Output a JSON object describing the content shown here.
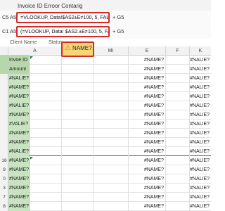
{
  "window": {
    "title": "Invoice ID Erroor Contarig"
  },
  "formula_rows": [
    {
      "ref": "C5",
      "ref2": "A5",
      "formula": "=VLOOKUP, Data!$AS2±E≠100, 5, FALSE)",
      "tail": "+ G5"
    },
    {
      "ref": "C1",
      "ref2": "A5",
      "formula": "(=VLOOKUP, Data! $AS2.±E≠100, 5, FALSE)",
      "tail": "+ G5"
    }
  ],
  "labels": {
    "client_name": "Client Name",
    "status": "Status"
  },
  "columns": [
    "A",
    "",
    "MI",
    "E",
    "F",
    "K"
  ],
  "error_badge": {
    "text": "NAME?"
  },
  "rows": [
    {
      "num": "",
      "a": "Invoe ID",
      "e": "#NAME?",
      "g": "#NALIE?",
      "flag": true
    },
    {
      "num": "",
      "a": "Amount",
      "e": "#NAME?",
      "g": "#NALIE?",
      "flag": false
    },
    {
      "num": "",
      "a": "#NALIE?",
      "e": "#NAME?",
      "g": "#NALIE?",
      "flag": false
    },
    {
      "num": "",
      "a": "#NAME?",
      "e": "#NAME?",
      "g": "#NALIE?",
      "flag": false
    },
    {
      "num": "",
      "a": "#NAME?",
      "e": "#NAME?",
      "g": "#NALIE?",
      "flag": false
    },
    {
      "num": "",
      "a": "#NALIE?",
      "e": "#NAME?",
      "g": "#NALIE?",
      "flag": false
    },
    {
      "num": "",
      "a": "#NAME?",
      "e": "#NAME?",
      "g": "#NALIE?",
      "flag": false
    },
    {
      "num": "",
      "a": "#VALIE?",
      "e": "#NAME?",
      "g": "#NALIE?",
      "flag": false
    },
    {
      "num": "",
      "a": "#NAME?",
      "e": "#NAME?",
      "g": "#NALIE?",
      "flag": false
    },
    {
      "num": "",
      "a": "#NAME?",
      "e": "#NAME?",
      "g": "#NALIE?",
      "flag": false
    },
    {
      "num": "",
      "a": "#NALIE?",
      "e": "#NAME?",
      "g": "#NALIE?",
      "flag": false
    },
    {
      "num": "16",
      "a": "#NAME?",
      "e": "#NAME?",
      "g": "#NALIE?",
      "flag": true
    },
    {
      "num": "9",
      "a": "#NAME?",
      "e": "#NAME?",
      "g": "#NALIE?",
      "flag": false
    },
    {
      "num": "0",
      "a": "#NAME?",
      "e": "#NAME?",
      "g": "#NALIE?",
      "flag": false
    },
    {
      "num": "3",
      "a": "#NAME?",
      "e": "#NAME?",
      "g": "#NALIE?",
      "flag": false
    },
    {
      "num": "7",
      "a": "#NAME?",
      "e": "#NAME?",
      "g": "#NALIE?",
      "flag": false
    },
    {
      "num": "8",
      "a": "#NAME?",
      "e": "#NAME?",
      "g": "#NALIE?",
      "flag": false
    }
  ]
}
